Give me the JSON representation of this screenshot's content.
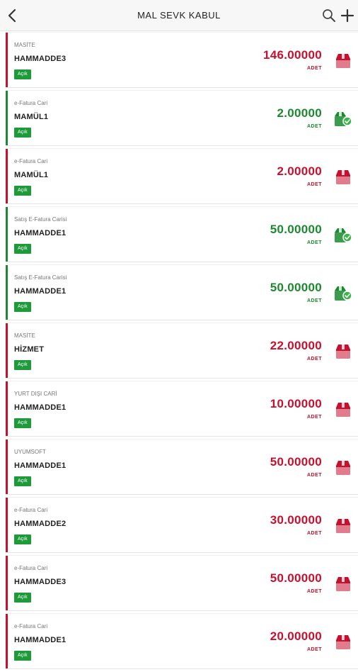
{
  "header": {
    "title": "MAL SEVK KABUL",
    "back_icon": "chevron-left-icon",
    "search_icon": "search-icon",
    "add_icon": "plus-icon"
  },
  "colors": {
    "open": "#c8102e",
    "done": "#1b8a2e",
    "badge": "#1e9a3a"
  },
  "items": [
    {
      "sub": "MASİTE",
      "name": "HAMMADDE3",
      "badge": "Açık",
      "qty": "146.00000",
      "unit": "ADET",
      "status": "open",
      "icon": "box-closed-icon"
    },
    {
      "sub": "e-Fatura Cari",
      "name": "MAMÜL1",
      "badge": "Açık",
      "qty": "2.00000",
      "unit": "ADET",
      "status": "done",
      "icon": "box-check-icon"
    },
    {
      "sub": "e-Fatura Cari",
      "name": "MAMÜL1",
      "badge": "Açık",
      "qty": "2.00000",
      "unit": "ADET",
      "status": "open",
      "icon": "box-closed-icon"
    },
    {
      "sub": "Satış E-Fatura Carisi",
      "name": "HAMMADDE1",
      "badge": "Açık",
      "qty": "50.00000",
      "unit": "ADET",
      "status": "done",
      "icon": "box-check-icon"
    },
    {
      "sub": "Satış E-Fatura Carisi",
      "name": "HAMMADDE1",
      "badge": "Açık",
      "qty": "50.00000",
      "unit": "ADET",
      "status": "done",
      "icon": "box-check-icon"
    },
    {
      "sub": "MASİTE",
      "name": "HİZMET",
      "badge": "Açık",
      "qty": "22.00000",
      "unit": "ADET",
      "status": "open",
      "icon": "box-closed-icon"
    },
    {
      "sub": "YURT DIŞI CARİ",
      "name": "HAMMADDE1",
      "badge": "Açık",
      "qty": "10.00000",
      "unit": "ADET",
      "status": "open",
      "icon": "box-closed-icon"
    },
    {
      "sub": "UYUMSOFT",
      "name": "HAMMADDE1",
      "badge": "Açık",
      "qty": "50.00000",
      "unit": "ADET",
      "status": "open",
      "icon": "box-closed-icon"
    },
    {
      "sub": "e-Fatura Cari",
      "name": "HAMMADDE2",
      "badge": "Açık",
      "qty": "30.00000",
      "unit": "ADET",
      "status": "open",
      "icon": "box-closed-icon"
    },
    {
      "sub": "e-Fatura Cari",
      "name": "HAMMADDE3",
      "badge": "Açık",
      "qty": "50.00000",
      "unit": "ADET",
      "status": "open",
      "icon": "box-closed-icon"
    },
    {
      "sub": "e-Fatura Cari",
      "name": "HAMMADDE1",
      "badge": "Açık",
      "qty": "20.00000",
      "unit": "ADET",
      "status": "open",
      "icon": "box-closed-icon"
    }
  ]
}
